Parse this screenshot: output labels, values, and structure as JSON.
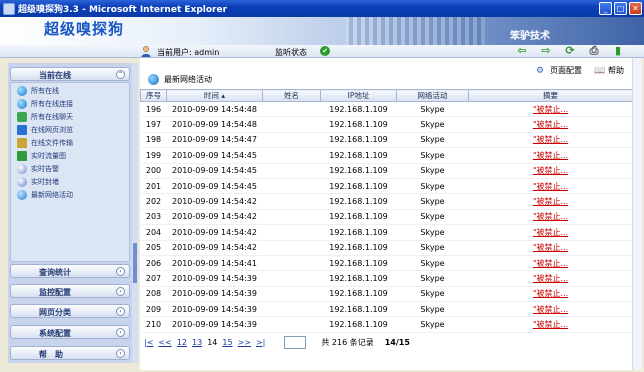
{
  "window": {
    "title": "超级嗅探狗3.3 - Microsoft Internet Explorer",
    "min": "_",
    "max": "□",
    "close": "✕"
  },
  "banner": {
    "logo": "超级嗅探狗",
    "company": "笨驴技术"
  },
  "userbar": {
    "current_user": "当前用户: admin",
    "monitor_status": "监听状态"
  },
  "toolbar": {
    "icons": [
      "back-arrow",
      "forward-arrow",
      "refresh",
      "print",
      "exit"
    ]
  },
  "sidebar": {
    "online_header": "当前在线",
    "online_items": [
      "所有在线",
      "所有在线连接",
      "所有在线聊天",
      "在线网页浏览",
      "在线文件传输",
      "实时流量图",
      "实时告警",
      "实时封堵",
      "最新网络活动"
    ],
    "sections": [
      "查询统计",
      "监控配置",
      "网页分类",
      "系统配置",
      "帮　助"
    ]
  },
  "main": {
    "page_config": "页面配置",
    "help": "帮助",
    "section_title": "最新网络活动",
    "columns": [
      "序号",
      "时间 ▴",
      "姓名",
      "IP地址",
      "网络活动",
      "摘要"
    ],
    "rows": [
      [
        "196",
        "2010-09-09 14:54:48",
        "",
        "192.168.1.109",
        "Skype",
        "\"被禁止..."
      ],
      [
        "197",
        "2010-09-09 14:54:48",
        "",
        "192.168.1.109",
        "Skype",
        "\"被禁止..."
      ],
      [
        "198",
        "2010-09-09 14:54:47",
        "",
        "192.168.1.109",
        "Skype",
        "\"被禁止..."
      ],
      [
        "199",
        "2010-09-09 14:54:45",
        "",
        "192.168.1.109",
        "Skype",
        "\"被禁止..."
      ],
      [
        "200",
        "2010-09-09 14:54:45",
        "",
        "192.168.1.109",
        "Skype",
        "\"被禁止..."
      ],
      [
        "201",
        "2010-09-09 14:54:45",
        "",
        "192.168.1.109",
        "Skype",
        "\"被禁止..."
      ],
      [
        "202",
        "2010-09-09 14:54:42",
        "",
        "192.168.1.109",
        "Skype",
        "\"被禁止..."
      ],
      [
        "203",
        "2010-09-09 14:54:42",
        "",
        "192.168.1.109",
        "Skype",
        "\"被禁止..."
      ],
      [
        "204",
        "2010-09-09 14:54:42",
        "",
        "192.168.1.109",
        "Skype",
        "\"被禁止..."
      ],
      [
        "205",
        "2010-09-09 14:54:42",
        "",
        "192.168.1.109",
        "Skype",
        "\"被禁止..."
      ],
      [
        "206",
        "2010-09-09 14:54:41",
        "",
        "192.168.1.109",
        "Skype",
        "\"被禁止..."
      ],
      [
        "207",
        "2010-09-09 14:54:39",
        "",
        "192.168.1.109",
        "Skype",
        "\"被禁止..."
      ],
      [
        "208",
        "2010-09-09 14:54:39",
        "",
        "192.168.1.109",
        "Skype",
        "\"被禁止..."
      ],
      [
        "209",
        "2010-09-09 14:54:39",
        "",
        "192.168.1.109",
        "Skype",
        "\"被禁止..."
      ],
      [
        "210",
        "2010-09-09 14:54:39",
        "",
        "192.168.1.109",
        "Skype",
        "\"被禁止..."
      ]
    ],
    "pager": {
      "first": "|<",
      "prev": "<<",
      "pages": [
        "12",
        "13",
        "14",
        "15"
      ],
      "current_page": "14",
      "next": ">>",
      "last": ">|",
      "total": "共 216 条记录",
      "position": "14/15"
    }
  },
  "colors": {
    "title_blue": "#0b3aa8",
    "logo_blue": "#1a57c2",
    "sidebar_bg": "#c8d4ec",
    "block_red": "#cc0000"
  }
}
